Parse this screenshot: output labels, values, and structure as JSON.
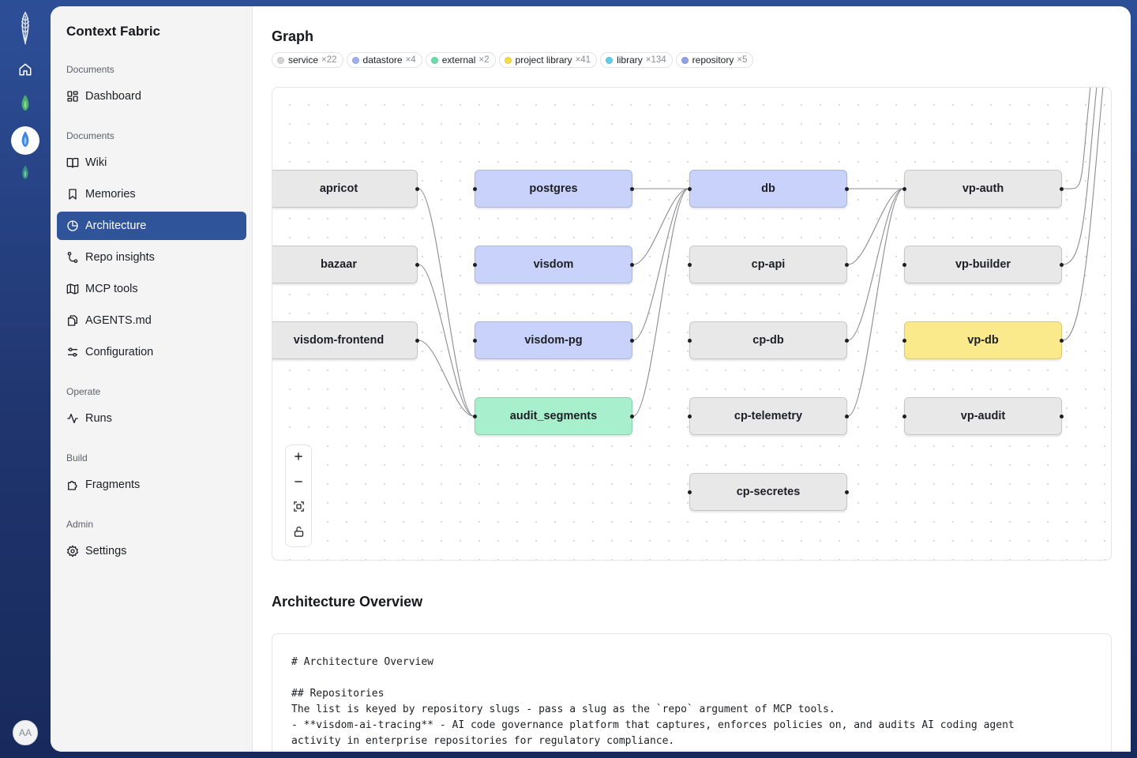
{
  "app": {
    "name": "Context Fabric",
    "avatar_initials": "AA",
    "colors": {
      "accent": "#30549a",
      "rail_gradient_top": "#2d4f98",
      "rail_gradient_bottom": "#182a5c"
    }
  },
  "rail": {
    "items": [
      {
        "name": "home-icon"
      },
      {
        "name": "green-flame-icon",
        "color": "#4caf6a"
      },
      {
        "name": "blue-flame-icon",
        "color": "#3f86e6",
        "active": true
      },
      {
        "name": "teal-flame-icon",
        "color": "#3b8f7e"
      }
    ]
  },
  "sidebar": {
    "sections": [
      {
        "label": "Documents",
        "items": [
          {
            "label": "Dashboard",
            "icon": "dashboard-icon"
          }
        ]
      },
      {
        "label": "Documents",
        "items": [
          {
            "label": "Wiki",
            "icon": "book-icon"
          },
          {
            "label": "Memories",
            "icon": "bookmark-icon"
          },
          {
            "label": "Architecture",
            "icon": "pie-chart-icon",
            "active": true
          },
          {
            "label": "Repo insights",
            "icon": "git-branch-icon"
          },
          {
            "label": "MCP tools",
            "icon": "map-icon"
          },
          {
            "label": "AGENTS.md",
            "icon": "files-icon"
          },
          {
            "label": "Configuration",
            "icon": "sliders-icon"
          }
        ]
      },
      {
        "label": "Operate",
        "items": [
          {
            "label": "Runs",
            "icon": "activity-icon"
          }
        ]
      },
      {
        "label": "Build",
        "items": [
          {
            "label": "Fragments",
            "icon": "puzzle-icon"
          }
        ]
      },
      {
        "label": "Admin",
        "items": [
          {
            "label": "Settings",
            "icon": "gear-icon"
          }
        ]
      }
    ]
  },
  "graph": {
    "title": "Graph",
    "legend": [
      {
        "label": "service",
        "count": "×22",
        "color": "#d4d4d6"
      },
      {
        "label": "datastore",
        "count": "×4",
        "color": "#9fb0f2"
      },
      {
        "label": "external",
        "count": "×2",
        "color": "#6fd9ab"
      },
      {
        "label": "project library",
        "count": "×41",
        "color": "#f5dc45"
      },
      {
        "label": "library",
        "count": "×134",
        "color": "#5fcdf0"
      },
      {
        "label": "repository",
        "count": "×5",
        "color": "#8ea0ea"
      }
    ],
    "node_colors": {
      "service": "#e8e8e9",
      "datastore": "#c9d2fb",
      "external": "#a8efcd",
      "project_library": "#fbea8c"
    },
    "nodes": [
      {
        "id": "apricot",
        "label": "apricot",
        "type": "service"
      },
      {
        "id": "bazaar",
        "label": "bazaar",
        "type": "service"
      },
      {
        "id": "visdom-frontend",
        "label": "visdom-frontend",
        "type": "service"
      },
      {
        "id": "postgres",
        "label": "postgres",
        "type": "datastore"
      },
      {
        "id": "visdom",
        "label": "visdom",
        "type": "datastore"
      },
      {
        "id": "visdom-pg",
        "label": "visdom-pg",
        "type": "datastore"
      },
      {
        "id": "audit_segments",
        "label": "audit_segments",
        "type": "external"
      },
      {
        "id": "db",
        "label": "db",
        "type": "datastore"
      },
      {
        "id": "cp-api",
        "label": "cp-api",
        "type": "service"
      },
      {
        "id": "cp-db",
        "label": "cp-db",
        "type": "service"
      },
      {
        "id": "cp-telemetry",
        "label": "cp-telemetry",
        "type": "service"
      },
      {
        "id": "cp-secretes",
        "label": "cp-secretes",
        "type": "service"
      },
      {
        "id": "vp-auth",
        "label": "vp-auth",
        "type": "service"
      },
      {
        "id": "vp-builder",
        "label": "vp-builder",
        "type": "service"
      },
      {
        "id": "vp-db",
        "label": "vp-db",
        "type": "project_library"
      },
      {
        "id": "vp-audit",
        "label": "vp-audit",
        "type": "service"
      }
    ],
    "edges": [
      [
        "apricot",
        "audit_segments"
      ],
      [
        "bazaar",
        "audit_segments"
      ],
      [
        "visdom-frontend",
        "audit_segments"
      ],
      [
        "postgres",
        "db"
      ],
      [
        "visdom",
        "db"
      ],
      [
        "visdom-pg",
        "db"
      ],
      [
        "audit_segments",
        "db"
      ],
      [
        "db",
        "vp-auth"
      ],
      [
        "cp-api",
        "vp-auth"
      ],
      [
        "cp-db",
        "vp-auth"
      ],
      [
        "cp-telemetry",
        "vp-auth"
      ],
      [
        "vp-auth",
        "offscreen"
      ],
      [
        "vp-builder",
        "offscreen"
      ],
      [
        "vp-db",
        "offscreen"
      ]
    ],
    "controls": [
      {
        "name": "zoom-in-button",
        "icon": "plus-icon"
      },
      {
        "name": "zoom-out-button",
        "icon": "minus-icon"
      },
      {
        "name": "fit-view-button",
        "icon": "fit-view-icon"
      },
      {
        "name": "lock-button",
        "icon": "unlock-icon"
      }
    ]
  },
  "overview": {
    "title": "Architecture Overview",
    "markdown_lines": [
      "# Architecture Overview",
      "",
      "## Repositories",
      "The list is keyed by repository slugs - pass a slug as the `repo` argument of MCP tools.",
      "- **visdom-ai-tracing** - AI code governance platform that captures, enforces policies on, and audits AI coding agent",
      "activity in enterprise repositories for regulatory compliance."
    ]
  }
}
